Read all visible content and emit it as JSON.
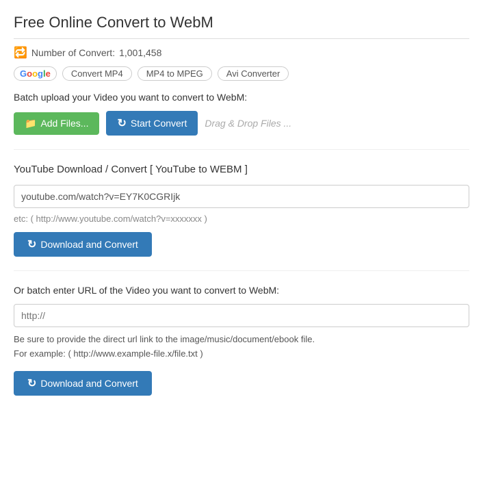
{
  "page": {
    "title": "Free Online Convert to WebM",
    "counter_icon": "🔁",
    "counter_label": "Number of Convert:",
    "counter_value": "1,001,458"
  },
  "nav": {
    "google_label": "Google",
    "links": [
      "Convert MP4",
      "MP4 to MPEG",
      "Avi Converter"
    ]
  },
  "upload": {
    "label": "Batch upload your Video you want to convert to WebM:",
    "add_files_btn": "Add Files...",
    "start_convert_btn": "Start Convert",
    "drag_drop_hint": "Drag & Drop Files ..."
  },
  "youtube": {
    "title": "YouTube Download / Convert [ YouTube to WEBM ]",
    "url_value": "youtube.com/watch?v=EY7K0CGRIjk",
    "hint": "etc: ( http://www.youtube.com/watch?v=xxxxxxx )",
    "download_btn": "Download and Convert"
  },
  "batch": {
    "title": "Or batch enter URL of the Video you want to convert to WebM:",
    "url_placeholder": "http://",
    "note_line1": "Be sure to provide the direct url link to the image/music/document/ebook file.",
    "note_line2": "For example: ( http://www.example-file.x/file.txt )",
    "download_btn": "Download and Convert"
  }
}
